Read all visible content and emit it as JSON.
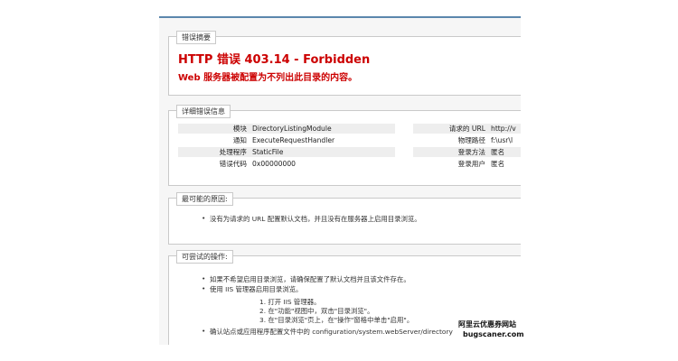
{
  "summary": {
    "heading": "错误摘要",
    "title": "HTTP 错误 403.14 - Forbidden",
    "message": "Web 服务器被配置为不列出此目录的内容。"
  },
  "details": {
    "heading": "详细错误信息",
    "left": [
      {
        "label": "模块",
        "value": "DirectoryListingModule"
      },
      {
        "label": "通知",
        "value": "ExecuteRequestHandler"
      },
      {
        "label": "处理程序",
        "value": "StaticFile"
      },
      {
        "label": "错误代码",
        "value": "0x00000000"
      }
    ],
    "right": [
      {
        "label": "请求的 URL",
        "value": "http://v"
      },
      {
        "label": "物理路径",
        "value": "f:\\usr\\l"
      },
      {
        "label": "登录方法",
        "value": "匿名"
      },
      {
        "label": "登录用户",
        "value": "匿名"
      }
    ]
  },
  "causes": {
    "heading": "最可能的原因:",
    "items": [
      "没有为请求的 URL 配置默认文档，并且没有在服务器上启用目录浏览。"
    ]
  },
  "actions": {
    "heading": "可尝试的操作:",
    "items": [
      "如果不希望启用目录浏览，请确保配置了默认文档并且该文件存在。",
      "使用 IIS 管理器启用目录浏览。"
    ],
    "steps": [
      "1. 打开 IIS 管理器。",
      "2. 在\"功能\"视图中，双击\"目录浏览\"。",
      "3. 在\"目录浏览\"页上，在\"操作\"窗格中单击\"启用\"。"
    ],
    "last": "确认站点或应用程序配置文件中的 configuration/system.webServer/directory"
  },
  "watermark": {
    "line1": "阿里云优惠券网站",
    "line2": "bugscaner.com"
  }
}
